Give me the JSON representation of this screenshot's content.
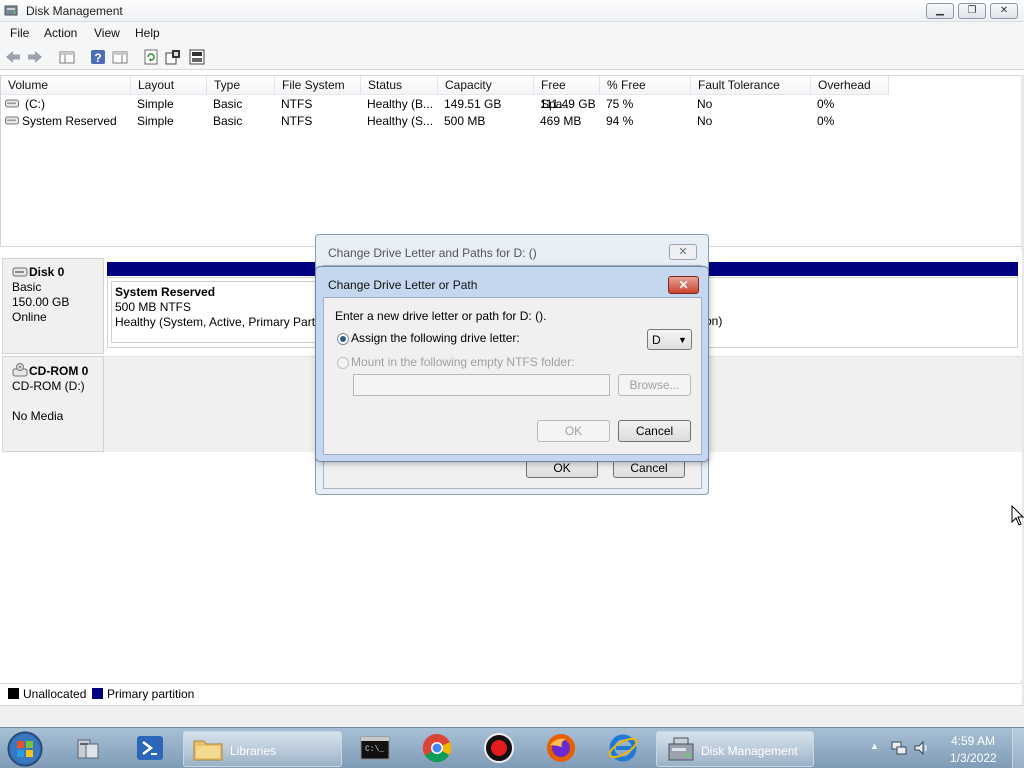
{
  "window": {
    "title": "Disk Management"
  },
  "menu": [
    "File",
    "Action",
    "View",
    "Help"
  ],
  "volume_table": {
    "columns": [
      "Volume",
      "Layout",
      "Type",
      "File System",
      "Status",
      "Capacity",
      "Free Spa...",
      "% Free",
      "Fault Tolerance",
      "Overhead"
    ],
    "rows": [
      [
        "(C:)",
        "Simple",
        "Basic",
        "NTFS",
        "Healthy (B...",
        "149.51 GB",
        "111.49 GB",
        "75 %",
        "No",
        "0%"
      ],
      [
        "System Reserved",
        "Simple",
        "Basic",
        "NTFS",
        "Healthy (S...",
        "500 MB",
        "469 MB",
        "94 %",
        "No",
        "0%"
      ]
    ]
  },
  "disk0": {
    "name": "Disk 0",
    "type": "Basic",
    "size": "150.00 GB",
    "state": "Online",
    "partition": {
      "name": "System Reserved",
      "fs": "500 MB NTFS",
      "status": "Healthy (System, Active, Primary Partiti"
    },
    "tail_text": "on)"
  },
  "cdrom0": {
    "name": "CD-ROM 0",
    "drive": "CD-ROM (D:)",
    "media": "No Media"
  },
  "legend": [
    "Unallocated",
    "Primary partition"
  ],
  "dialog_back": {
    "title": "Change Drive Letter and Paths for D: ()",
    "ok": "OK",
    "cancel": "Cancel"
  },
  "dialog_front": {
    "title": "Change Drive Letter or Path",
    "prompt": "Enter a new drive letter or path for D: ().",
    "option_assign": "Assign the following drive letter:",
    "option_mount": "Mount in the following empty NTFS folder:",
    "drive_letter": "D",
    "browse": "Browse...",
    "ok": "OK",
    "cancel": "Cancel"
  },
  "taskbar": {
    "libraries": "Libraries",
    "disk_management": "Disk Management",
    "time": "4:59 AM",
    "date": "1/3/2022"
  },
  "colors": {
    "primary_partition": "#000080",
    "unallocated": "#000000",
    "close_button": "#c9442f"
  }
}
